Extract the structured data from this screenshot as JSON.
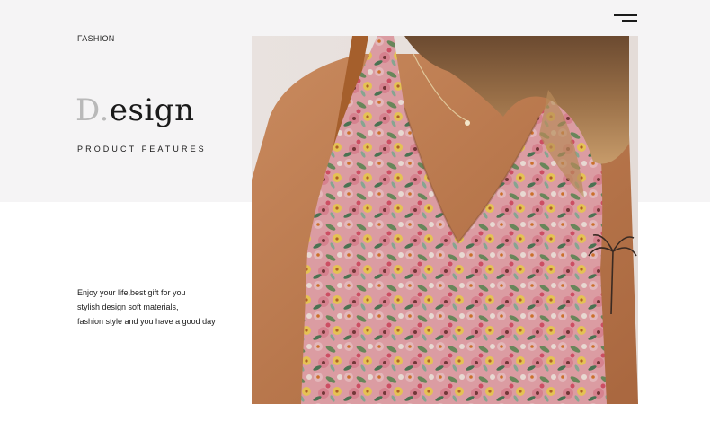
{
  "header": {
    "brand": "FASHION",
    "menu_icon": "hamburger-menu-icon"
  },
  "hero": {
    "title_initial": "D.",
    "title_rest": "esign",
    "subtitle": "PRODUCT FEATURES"
  },
  "description": {
    "lines": [
      "Enjoy your life,best gift for you",
      "stylish design soft materials,",
      "fashion style and you have a good day"
    ]
  },
  "colors": {
    "band_background": "#f5f4f5",
    "page_background": "#ffffff",
    "text": "#1a1a1a",
    "accent_gray": "#b9b9b9"
  }
}
